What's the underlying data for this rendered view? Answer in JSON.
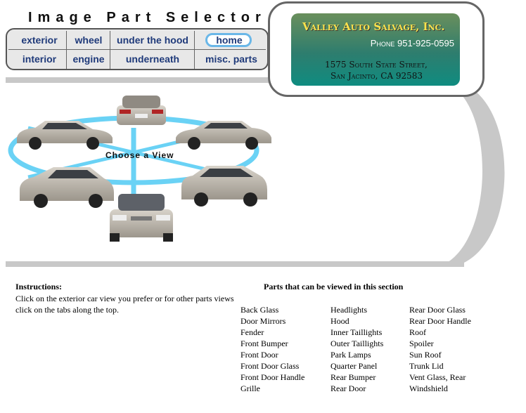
{
  "title": "Image Part Selector",
  "nav": {
    "row1": [
      "exterior",
      "wheel",
      "under the hood",
      "home"
    ],
    "row2": [
      "interior",
      "engine",
      "underneath",
      "misc. parts"
    ]
  },
  "logo": {
    "name": "Valley Auto Salvage, Inc.",
    "phone": "Phone 951-925-0595",
    "address_line1": "1575 South State Street,",
    "address_line2": "San Jacinto, CA 92583"
  },
  "selector": {
    "label": "Choose a View"
  },
  "instructions": {
    "heading": "Instructions:",
    "body": "Click on the exterior car view you prefer or for other parts views click on the tabs along the top."
  },
  "parts": {
    "heading": "Parts that can be viewed in this section",
    "columns": [
      [
        "Back Glass",
        "Door Mirrors",
        "Fender",
        "Front Bumper",
        "Front Door",
        "Front Door Glass",
        "Front Door Handle",
        "Grille"
      ],
      [
        "Headlights",
        "Hood",
        "Inner Taillights",
        "Outer Taillights",
        "Park Lamps",
        "Quarter Panel",
        "Rear Bumper",
        "Rear Door"
      ],
      [
        "Rear Door Glass",
        "Rear Door Handle",
        "Roof",
        "Spoiler",
        "Sun Roof",
        "Trunk Lid",
        "Vent Glass, Rear",
        "Windshield"
      ]
    ]
  },
  "colors": {
    "accent_blue": "#6ab7e8",
    "nav_text": "#1f3a7a",
    "car_silver": "#bdb7ac"
  }
}
